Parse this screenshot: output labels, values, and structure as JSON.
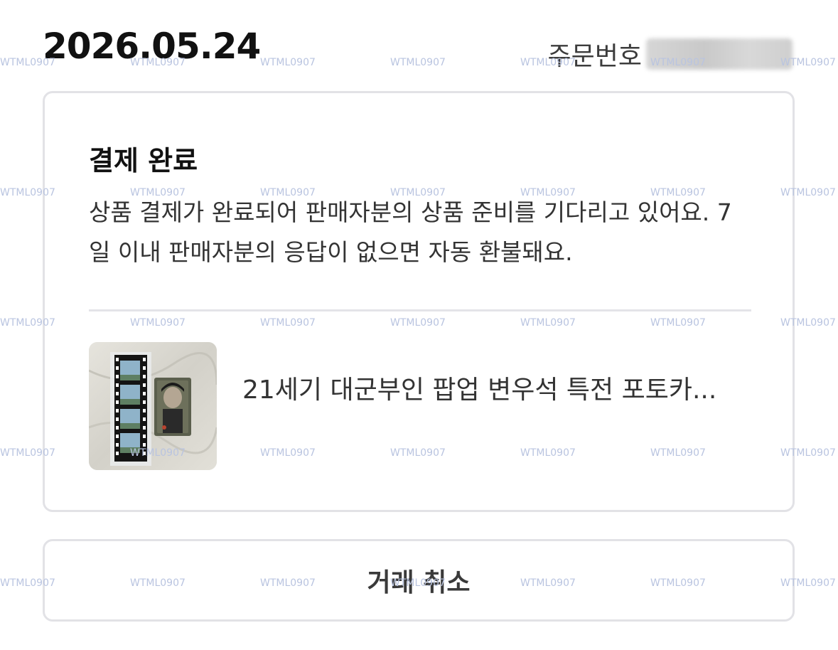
{
  "header": {
    "date": "2026.05.24",
    "order_label": "주문번호",
    "order_value_hidden": true
  },
  "status": {
    "title": "결제 완료",
    "description": "상품 결제가 완료되어 판매자분의 상품 준비를 기다리고 있어요. 7일 이내 판매자분의 응답이 없으면 자동 환불돼요."
  },
  "product": {
    "name": "21세기 대군부인 팝업 변우석 특전 포토카..."
  },
  "actions": {
    "cancel_label": "거래 취소"
  },
  "watermark": {
    "text": "WTML0907"
  }
}
